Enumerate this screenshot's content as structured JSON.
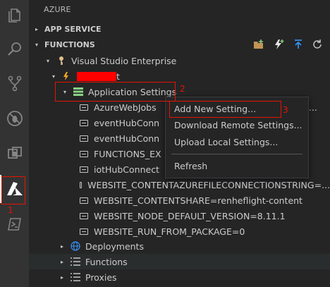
{
  "sidebar": {
    "title": "AZURE",
    "sections": [
      {
        "label": "APP SERVICE",
        "twistie": "▸"
      },
      {
        "label": "FUNCTIONS",
        "twistie": "▾"
      }
    ],
    "subscription": "Visual Studio Enterprise",
    "function_app_suffix": "t",
    "app_settings_label": "Application Settings",
    "settings": [
      "AzureWebJobs",
      "eventHubConn",
      "eventHubConn",
      "FUNCTIONS_EX",
      "iotHubConnect",
      "WEBSITE_CONTENTAZUREFILECONNECTIONSTRING=...",
      "WEBSITE_CONTENTSHARE=renheflight-content",
      "WEBSITE_NODE_DEFAULT_VERSION=8.11.1",
      "WEBSITE_RUN_FROM_PACKAGE=0"
    ],
    "truncated_tail": "t...",
    "groups": [
      "Deployments",
      "Functions",
      "Proxies"
    ]
  },
  "context_menu": {
    "items": [
      "Add New Setting...",
      "Download Remote Settings...",
      "Upload Local Settings...",
      "Refresh"
    ]
  },
  "annotations": {
    "n1": "1",
    "n2": "2",
    "n3": "3"
  },
  "colors": {
    "accent": "#0e70c0",
    "annotation": "#e51400",
    "azure": "#0089d6",
    "key": "#e2c08d"
  }
}
